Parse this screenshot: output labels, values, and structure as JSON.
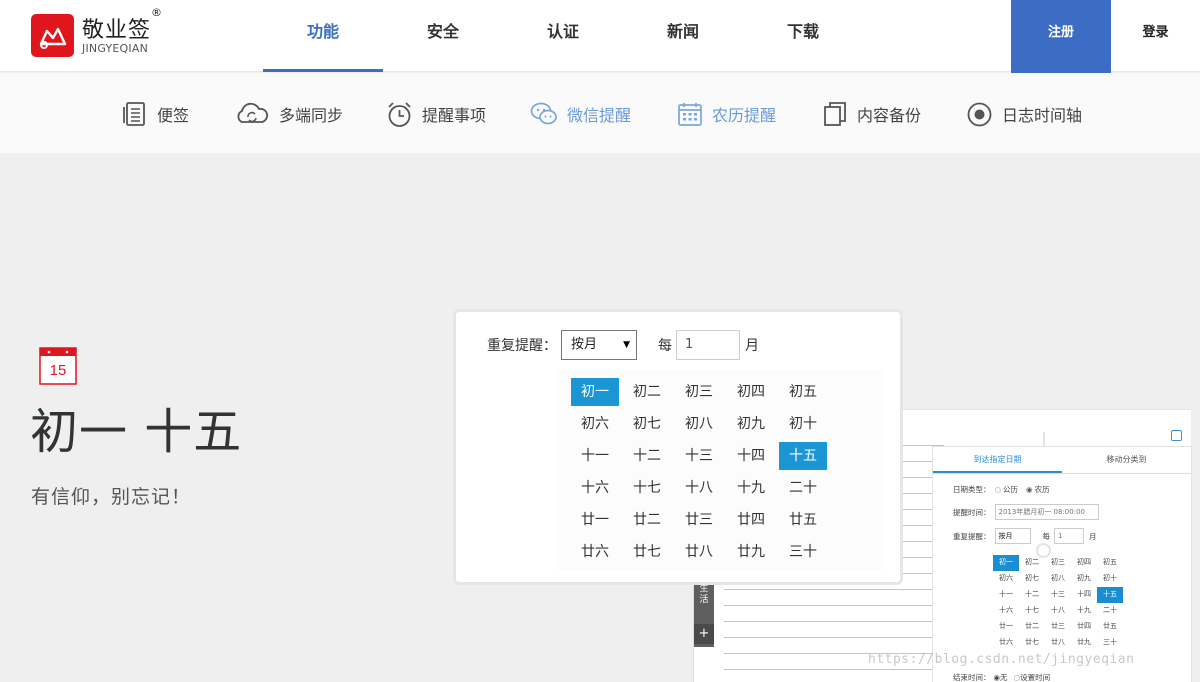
{
  "brand": {
    "name": "敬业签",
    "registered_mark": "®",
    "sub": "JINGYEQIAN",
    "logo_color": "#e0151e"
  },
  "nav": {
    "items": [
      {
        "label": "功能",
        "active": true
      },
      {
        "label": "安全",
        "active": false
      },
      {
        "label": "认证",
        "active": false
      },
      {
        "label": "新闻",
        "active": false
      },
      {
        "label": "下载",
        "active": false
      }
    ],
    "register_label": "注册",
    "login_label": "登录",
    "accent_color": "#3d6cc5"
  },
  "subnav": {
    "items": [
      {
        "label": "便签",
        "icon": "notes-icon"
      },
      {
        "label": "多端同步",
        "icon": "cloud-sync-icon"
      },
      {
        "label": "提醒事项",
        "icon": "alarm-clock-icon"
      },
      {
        "label": "微信提醒",
        "icon": "wechat-icon"
      },
      {
        "label": "农历提醒",
        "icon": "calendar-grid-icon"
      },
      {
        "label": "内容备份",
        "icon": "copy-icon"
      },
      {
        "label": "日志时间轴",
        "icon": "timeline-icon"
      }
    ]
  },
  "hero": {
    "calendar_day": "15",
    "title": "初一 十五",
    "subtitle": "有信仰，别忘记！"
  },
  "popup": {
    "repeat_label": "重复提醒：",
    "repeat_value": "按月",
    "every_label": "每",
    "interval_value": "1",
    "unit_label": "月",
    "days": [
      "初一",
      "初二",
      "初三",
      "初四",
      "初五",
      "初六",
      "初七",
      "初八",
      "初九",
      "初十",
      "十一",
      "十二",
      "十三",
      "十四",
      "十五",
      "十六",
      "十七",
      "十八",
      "十九",
      "二十",
      "廿一",
      "廿二",
      "廿三",
      "廿四",
      "廿五",
      "廿六",
      "廿七",
      "廿八",
      "廿九",
      "三十"
    ],
    "selected_days": [
      "初一",
      "十五"
    ],
    "highlight_color": "#1a96d4"
  },
  "bg_app": {
    "tabs": [
      "到达指定日期",
      "移动分类到"
    ],
    "date_type_label": "日期类型：",
    "date_type_options": [
      "公历",
      "农历"
    ],
    "remind_time_label": "提醒时间：",
    "remind_time_value": "2013年腊月初一 08:00:00",
    "repeat_label": "重复提醒：",
    "repeat_value": "按月",
    "every_label": "每",
    "interval_value": "1",
    "unit_label": "月",
    "end_time_label": "结束时间：",
    "end_time_options": [
      "无",
      "设置时间"
    ],
    "sidebar_labels": [
      "生",
      "活"
    ],
    "plus_label": "+"
  },
  "watermark": "https://blog.csdn.net/jingyeqian"
}
